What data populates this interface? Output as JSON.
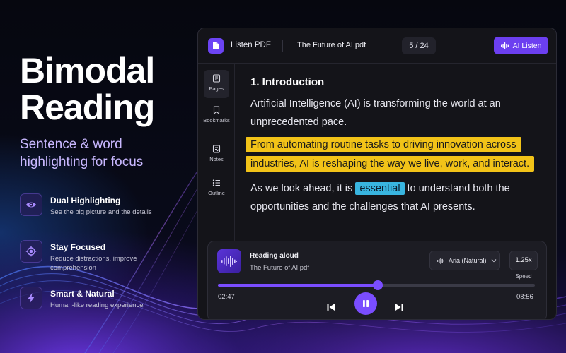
{
  "hero": {
    "title_line1": "Bimodal",
    "title_line2": "Reading",
    "subtitle_line1": "Sentence & word",
    "subtitle_line2": "highlighting for focus"
  },
  "features": [
    {
      "title": "Dual Highlighting",
      "desc_line1": "See the big picture and the details",
      "desc_line2": "",
      "icon": "eye-icon"
    },
    {
      "title": "Stay Focused",
      "desc_line1": "Reduce distractions, improve",
      "desc_line2": "comprehension",
      "icon": "target-icon"
    },
    {
      "title": "Smart & Natural",
      "desc_line1": "Human-like reading experience",
      "desc_line2": "",
      "icon": "lightning-icon"
    }
  ],
  "app": {
    "name": "Listen PDF",
    "file_name": "The Future of AI.pdf",
    "page_counter": "5 / 24",
    "ai_listen_label": "AI Listen",
    "accent": "#6c3ff0"
  },
  "sidebar": {
    "items": [
      {
        "label": "Pages",
        "icon": "pages-icon"
      },
      {
        "label": "Bookmarks",
        "icon": "bookmark-icon"
      },
      {
        "label": "Notes",
        "icon": "notes-icon"
      },
      {
        "label": "Outline",
        "icon": "outline-icon"
      }
    ]
  },
  "document": {
    "section_title": "1. Introduction",
    "para1_line1": "Artificial Intelligence (AI) is transforming the world at an",
    "para1_line2": "unprecedented pace.",
    "highlight_line1": "From automating routine tasks to driving innovation across",
    "highlight_line2": "industries, AI is reshaping the way we live, work, and interact.",
    "para3_before": "As we look ahead, it is",
    "para3_word": "essential",
    "para3_after": "to understand both the",
    "para3_line2": "opportunities and the challenges that AI presents.",
    "sentence_highlight_color": "#f2c318",
    "word_highlight_color": "#39b5e0"
  },
  "player": {
    "status": "Reading aloud",
    "file_name": "The Future of AI.pdf",
    "voice": "Aria (Natural)",
    "speed": "1.25x",
    "speed_label": "Speed",
    "elapsed": "02:47",
    "total": "08:56",
    "progress": 0.505
  }
}
